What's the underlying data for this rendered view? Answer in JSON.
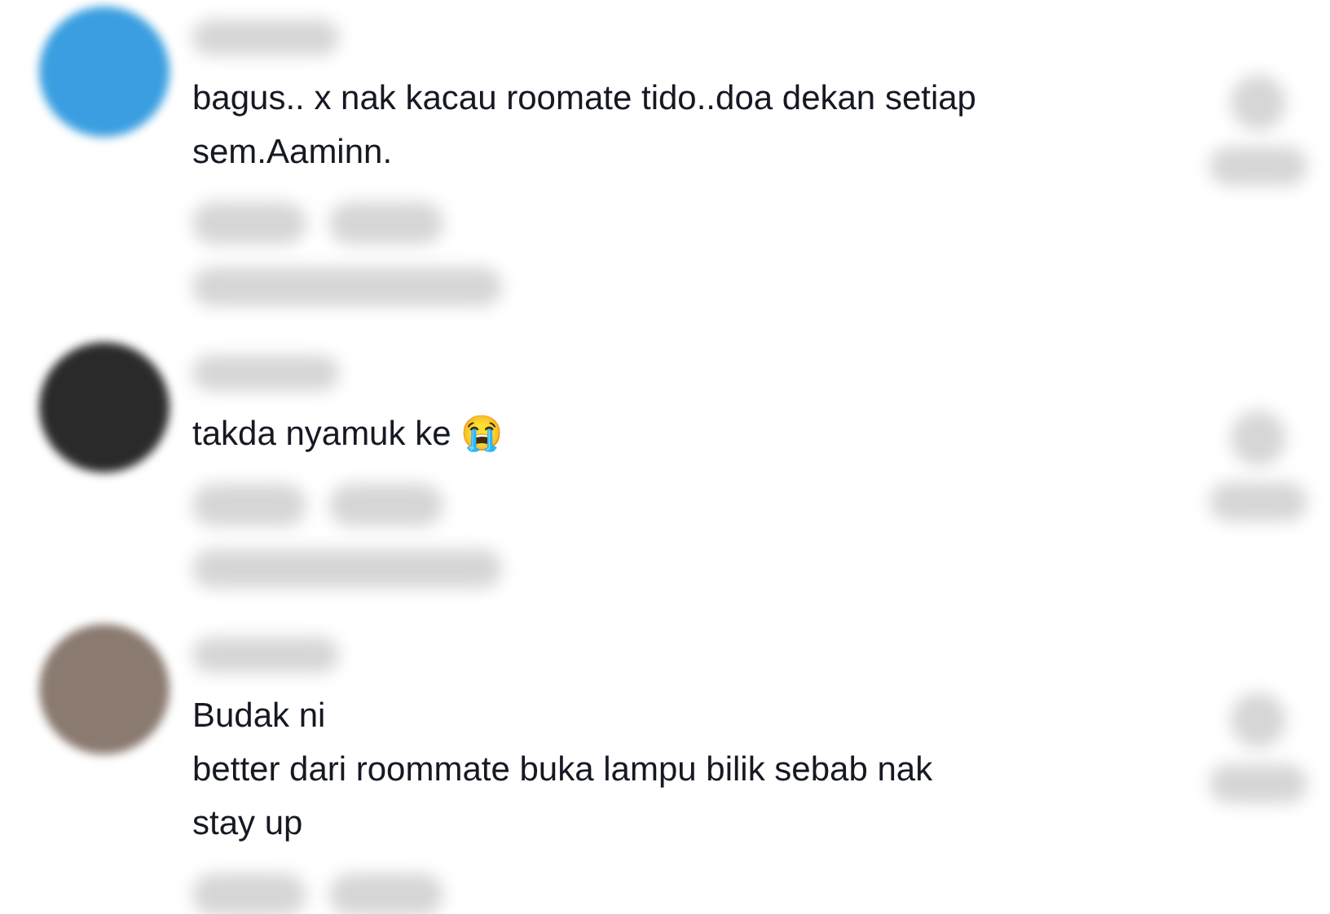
{
  "comments": [
    {
      "avatar": {
        "color": "#3a9ee0"
      },
      "lines": [
        "bagus.. x nak kacau roomate tido..doa dekan setiap",
        "sem.Aaminn."
      ],
      "has_replies": true
    },
    {
      "avatar": {
        "color": "#2a2a2a"
      },
      "lines": [
        "takda nyamuk ke 😭"
      ],
      "has_replies": true
    },
    {
      "avatar": {
        "color": "#8a7a70"
      },
      "lines": [
        "Budak ni",
        "better dari roommate buka lampu bilik sebab nak",
        "stay up"
      ],
      "has_replies": false
    }
  ]
}
